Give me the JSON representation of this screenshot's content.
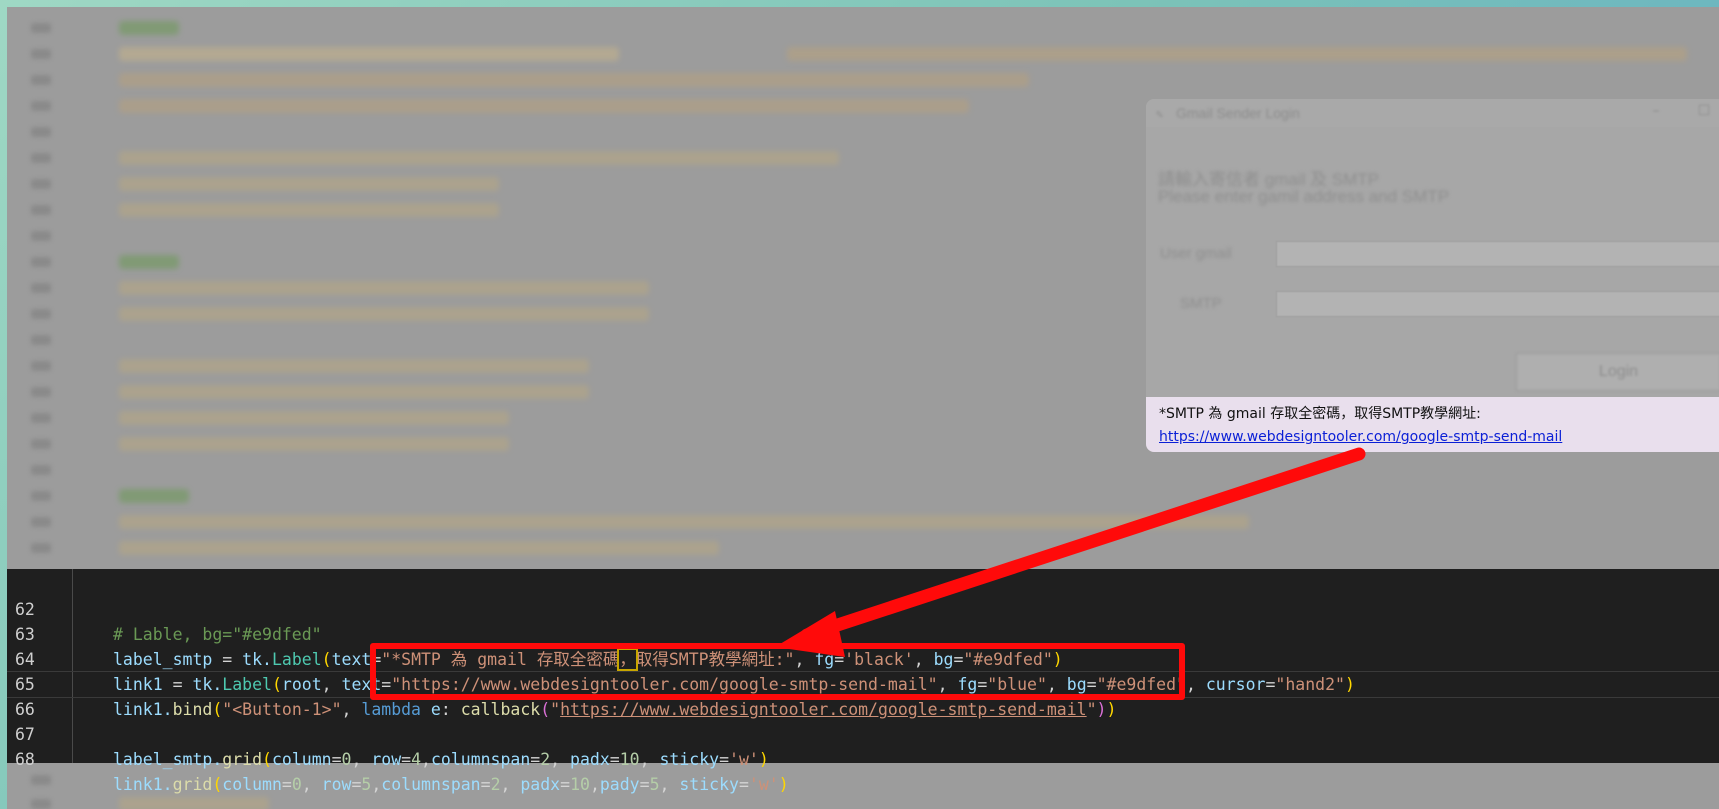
{
  "editor": {
    "lines": [
      {
        "num": "62"
      },
      {
        "num": "63"
      },
      {
        "num": "64"
      },
      {
        "num": "65"
      },
      {
        "num": "66"
      },
      {
        "num": "67"
      },
      {
        "num": "68"
      }
    ],
    "line62": {
      "comment": "# Lable, bg=\"#e9dfed\""
    },
    "line63": {
      "var": "label_smtp",
      "eq": " = ",
      "mod": "tk.",
      "cls": "Label",
      "open": "(",
      "kw1": "text",
      "eqs1": "=",
      "s1a": "\"*SMTP 為 gmail 存取全密碼",
      "s1cur": "，",
      "s1b": "取得SMTP教學網址:\"",
      "comma1": ", ",
      "kw2": "fg",
      "eqs2": "=",
      "s2": "'black'",
      "comma2": ", ",
      "kw3": "bg",
      "eqs3": "=",
      "s3": "\"#e9dfed\"",
      "close": ")"
    },
    "line64": {
      "var": "link1",
      "eq": " = ",
      "mod": "tk.",
      "cls": "Label",
      "open": "(",
      "arg0": "root",
      "comma0": ", ",
      "kw1": "text",
      "eqs1": "=",
      "s1": "\"https://www.webdesigntooler.com/google-smtp-send-mail\"",
      "comma1": ", ",
      "kw2": "fg",
      "eqs2": "=",
      "s2": "\"blue\"",
      "comma2": ", ",
      "kw3": "bg",
      "eqs3": "=",
      "s3": "\"#e9dfed\"",
      "comma3": ", ",
      "kw4": "cursor",
      "eqs4": "=",
      "s4": "\"hand2\"",
      "close": ")"
    },
    "line65": {
      "var": "link1.",
      "fn": "bind",
      "open": "(",
      "s1": "\"<Button-1>\"",
      "comma1": ", ",
      "kw": "lambda",
      "arg": " e",
      "colon": ": ",
      "fn2": "callback",
      "open2": "(",
      "q1": "\"",
      "url": "https://www.webdesigntooler.com/google-smtp-send-mail",
      "q2": "\"",
      "close2": ")",
      "close": ")"
    },
    "line67": {
      "var": "label_smtp.",
      "fn": "grid",
      "open": "(",
      "a1": "column",
      "v1": "0",
      "a2": "row",
      "v2": "4",
      "a3": "columnspan",
      "v3": "2",
      "a4": "padx",
      "v4": "10",
      "a5": "sticky",
      "v5": "'w'",
      "close": ")"
    },
    "line68": {
      "var": "link1.",
      "fn": "grid",
      "open": "(",
      "a1": "column",
      "v1": "0",
      "a2": "row",
      "v2": "5",
      "a3": "columnspan",
      "v3": "2",
      "a4": "padx",
      "v4": "10",
      "a5": "pady",
      "v5": "5",
      "a6": "sticky",
      "v6": "'w'",
      "close": ")"
    }
  },
  "tk_window": {
    "title": "Gmail Sender Login",
    "message_zh": "請輸入寄信者 gmail 及 SMTP",
    "message_en": "Please enter gamil address and SMTP",
    "user_label": "User gmail",
    "smtp_label": "SMTP",
    "login_button": "Login",
    "smtp_note": "*SMTP 為 gmail 存取全密碼，取得SMTP教學網址:",
    "link_text": "https://www.webdesigntooler.com/google-smtp-send-mail",
    "minimize_glyph": "–",
    "maximize_glyph": "☐",
    "bg_color": "#e9dfed"
  },
  "annotation": {
    "box_color": "#ff0a0a",
    "arrow_color": "#ff0a0a"
  }
}
